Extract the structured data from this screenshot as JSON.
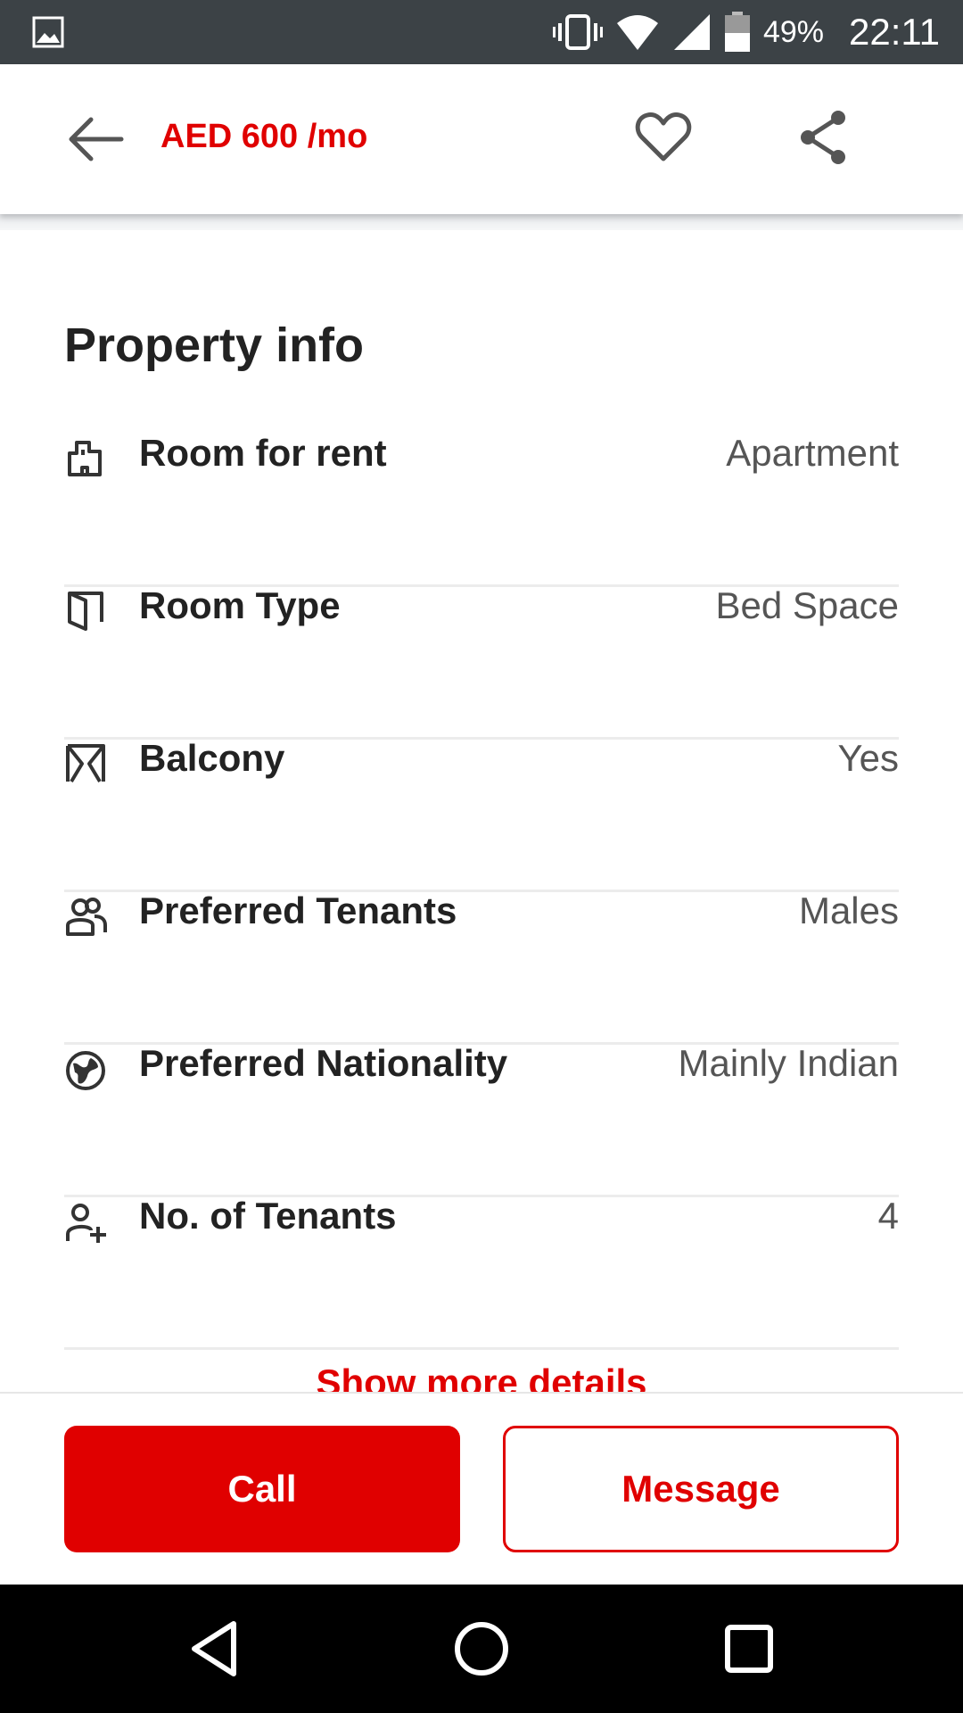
{
  "status_bar": {
    "battery": "49%",
    "time": "22:11",
    "icons": [
      "image-icon",
      "vibrate-icon",
      "wifi-icon",
      "signal-icon",
      "battery-icon"
    ]
  },
  "header": {
    "price": "AED 600 /mo",
    "icons": [
      "back-arrow-icon",
      "heart-icon",
      "share-icon"
    ],
    "accent_color": "#e00000"
  },
  "property_info": {
    "title": "Property info",
    "rows": [
      {
        "label": "Room for rent",
        "value": "Apartment",
        "icon": "building-icon"
      },
      {
        "label": "Room Type",
        "value": "Bed Space",
        "icon": "door-icon"
      },
      {
        "label": "Balcony",
        "value": "Yes",
        "icon": "balcony-icon"
      },
      {
        "label": "Preferred Tenants",
        "value": "Males",
        "icon": "people-icon"
      },
      {
        "label": "Preferred Nationality",
        "value": "Mainly Indian",
        "icon": "globe-icon"
      },
      {
        "label": "No. of Tenants",
        "value": "4",
        "icon": "add-person-icon"
      }
    ],
    "show_more": "Show more details"
  },
  "actions": {
    "call": "Call",
    "message": "Message"
  },
  "nav_bar": {
    "icons": [
      "nav-back-icon",
      "nav-home-icon",
      "nav-recents-icon"
    ]
  }
}
